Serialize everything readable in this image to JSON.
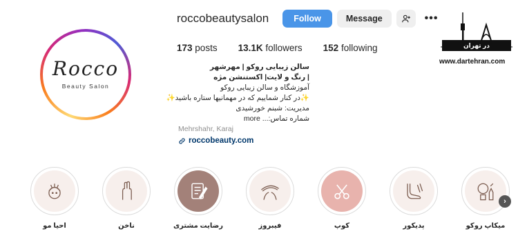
{
  "profile": {
    "username": "roccobeautysalon",
    "logo_script": "Rocco",
    "logo_sub": "Beauty Salon"
  },
  "actions": {
    "follow_label": "Follow",
    "message_label": "Message"
  },
  "stats": {
    "posts_count": "173",
    "posts_label": "posts",
    "followers_count": "13.1K",
    "followers_label": "followers",
    "following_count": "152",
    "following_label": "following"
  },
  "bio": {
    "line1": "سالن زیبایی روکو | مهرشهر",
    "line2": "| رنگ و لایت| اکستنشن مژه",
    "line3": "آموزشگاه و سالن زیبایی روکو",
    "line4": "✨در کنار شماییم که در مهمانیها ستاره باشید✨",
    "line5": "مدیریت: شبنم خورشیدی",
    "line6": "شماره تماس:... more",
    "location": "Mehrshahr, Karaj",
    "website": "roccobeauty.com"
  },
  "watermark": {
    "band_text": "در تهران",
    "site": "www.dartehran.com"
  },
  "highlights": [
    {
      "label": "احیا مو",
      "icon": "hair-treatment-icon"
    },
    {
      "label": "ناخن",
      "icon": "nail-icon"
    },
    {
      "label": "رضایت مشتری",
      "icon": "customer-satisfaction-icon"
    },
    {
      "label": "فیبروز",
      "icon": "eyebrow-icon"
    },
    {
      "label": "کوپ",
      "icon": "haircut-icon"
    },
    {
      "label": "پدیکور",
      "icon": "pedicure-icon"
    },
    {
      "label": "میکاپ روکو",
      "icon": "makeup-icon"
    }
  ],
  "colors": {
    "follow_button": "#4a95e8",
    "secondary_button": "#efefef",
    "link": "#00376b"
  }
}
